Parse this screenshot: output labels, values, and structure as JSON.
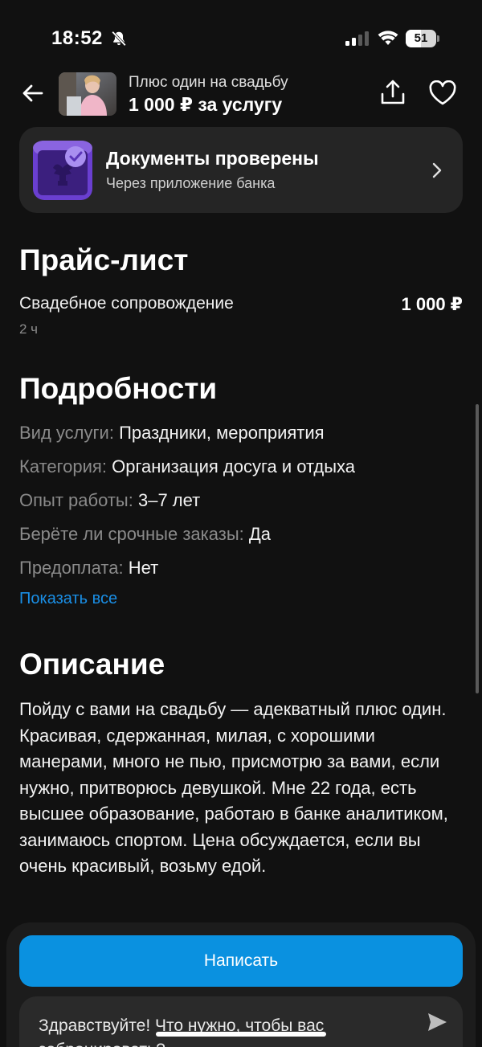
{
  "status_bar": {
    "time": "18:52",
    "battery_level": "51",
    "battery_fraction": 0.51
  },
  "header": {
    "title": "Плюс один на свадьбу",
    "price": "1 000 ₽ за услугу",
    "icons": [
      "back-arrow-icon",
      "share-icon",
      "heart-icon"
    ]
  },
  "verification": {
    "title": "Документы проверены",
    "subtitle": "Через приложение банка",
    "colors": {
      "icon_bg": "#6a3fd0",
      "icon_check": "#a98ff0"
    }
  },
  "price_list": {
    "heading": "Прайс-лист",
    "items": [
      {
        "name": "Свадебное сопровождение",
        "duration": "2 ч",
        "price": "1 000 ₽"
      }
    ]
  },
  "details": {
    "heading": "Подробности",
    "rows": [
      {
        "label": "Вид услуги:",
        "value": "Праздники, мероприятия"
      },
      {
        "label": "Категория:",
        "value": "Организация досуга и отдыха"
      },
      {
        "label": "Опыт работы:",
        "value": "3–7 лет"
      },
      {
        "label": "Берёте ли срочные заказы:",
        "value": "Да"
      },
      {
        "label": "Предоплата:",
        "value": "Нет"
      }
    ],
    "show_all": "Показать все"
  },
  "description": {
    "heading": "Описание",
    "text": "Пойду с вами на свадьбу — адекватный плюс один. Красивая, сдержанная, милая, с хорошими манерами, много не пью, присмотрю за вами, если нужно, притворюсь девушкой. Мне 22 года, есть высшее образование, работаю в банке аналитиком, занимаюсь спортом. Цена обсуждается, если вы очень красивый, возьму едой."
  },
  "actions": {
    "write_button": "Написать",
    "message_text": "Здравствуйте! Что нужно, чтобы вас забронировать?"
  },
  "colors": {
    "background": "#111111",
    "card": "#252525",
    "accent": "#0a91e0",
    "link": "#1a8fe6",
    "muted_text": "#8a8a8a"
  }
}
